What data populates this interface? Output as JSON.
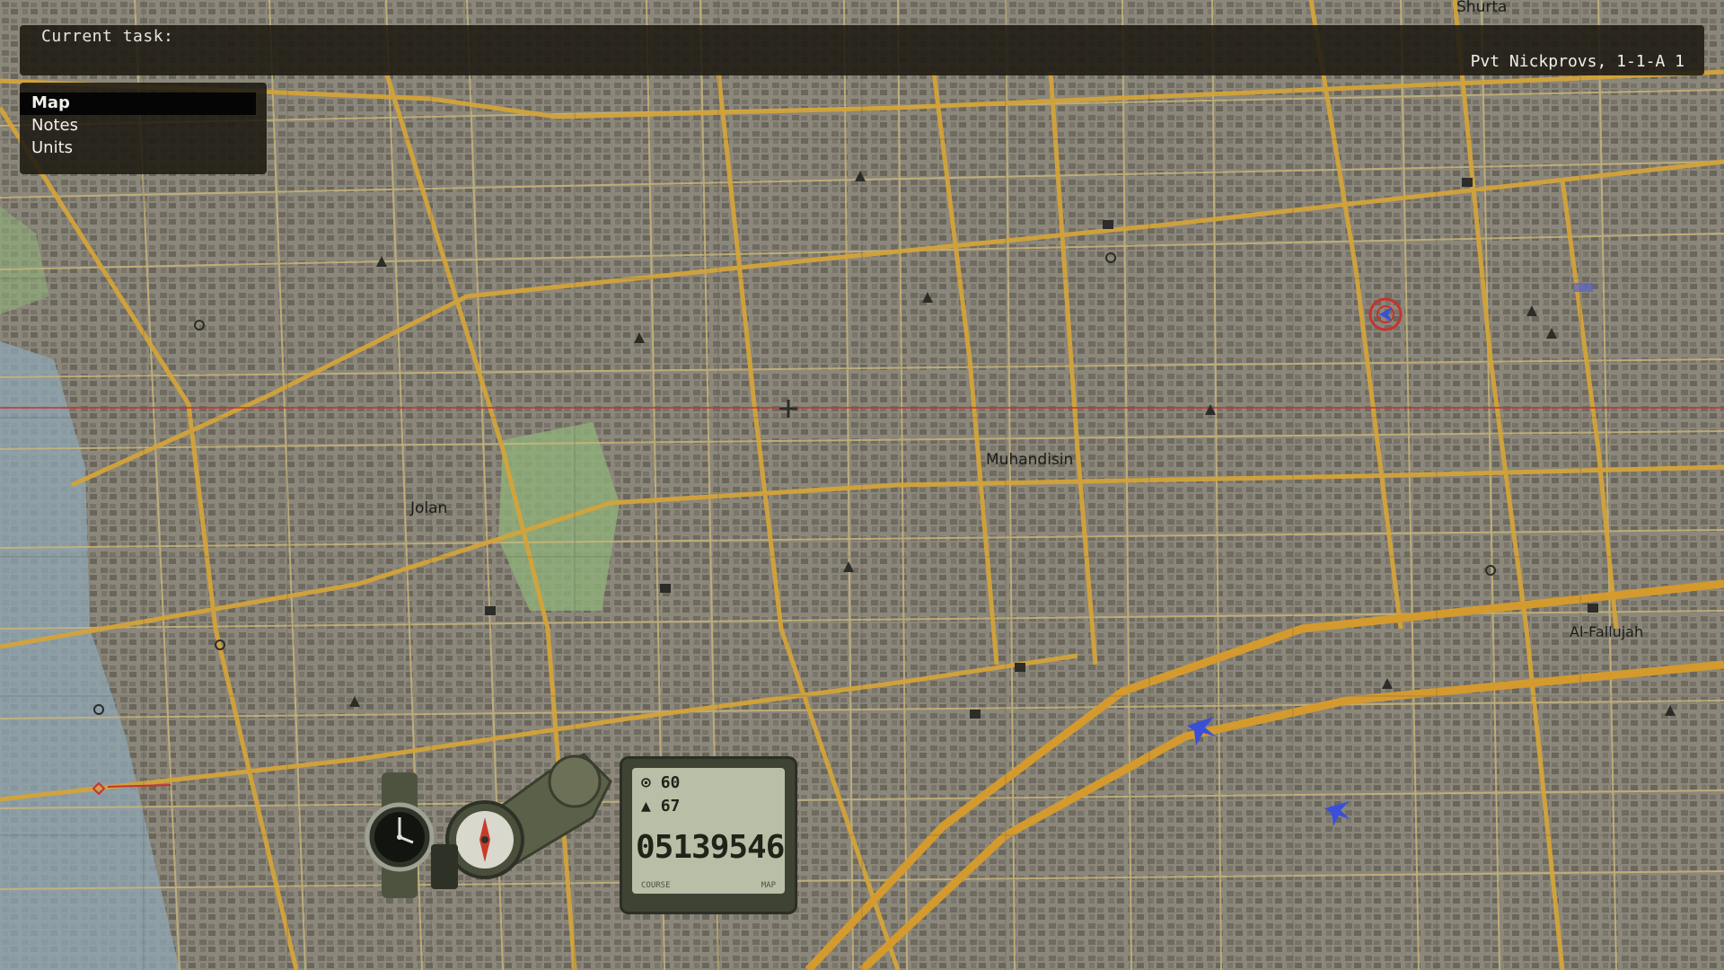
{
  "topbar": {
    "task_label": "Current task:",
    "player_label": "Pvt Nickprovs, 1-1-A 1"
  },
  "menu": {
    "items": [
      {
        "label": "Map",
        "active": true
      },
      {
        "label": "Notes",
        "active": false
      },
      {
        "label": "Units",
        "active": false
      }
    ]
  },
  "map": {
    "places": {
      "shurta": "Shurta",
      "muhandisin": "Muhandisin",
      "jolan": "Jolan",
      "al_fallujah": "Al-Fallujah"
    }
  },
  "gadgets": {
    "watch_icon": "wristwatch-icon",
    "compass_icon": "compass-icon",
    "gps": {
      "heading": "60",
      "altitude": "67",
      "coordinates": "05139546",
      "footer_left": "COURSE",
      "footer_right": "MAP"
    }
  },
  "colors": {
    "map_bg": "#8e8b7e",
    "major_road": "#d4a43a",
    "minor_road": "#c9b57a",
    "water": "#8fa7b5",
    "park": "#8fb07a",
    "grid_red": "#c8322e",
    "ui_panel": "#1e1a12",
    "friendly_blue": "#3a4fd8"
  }
}
